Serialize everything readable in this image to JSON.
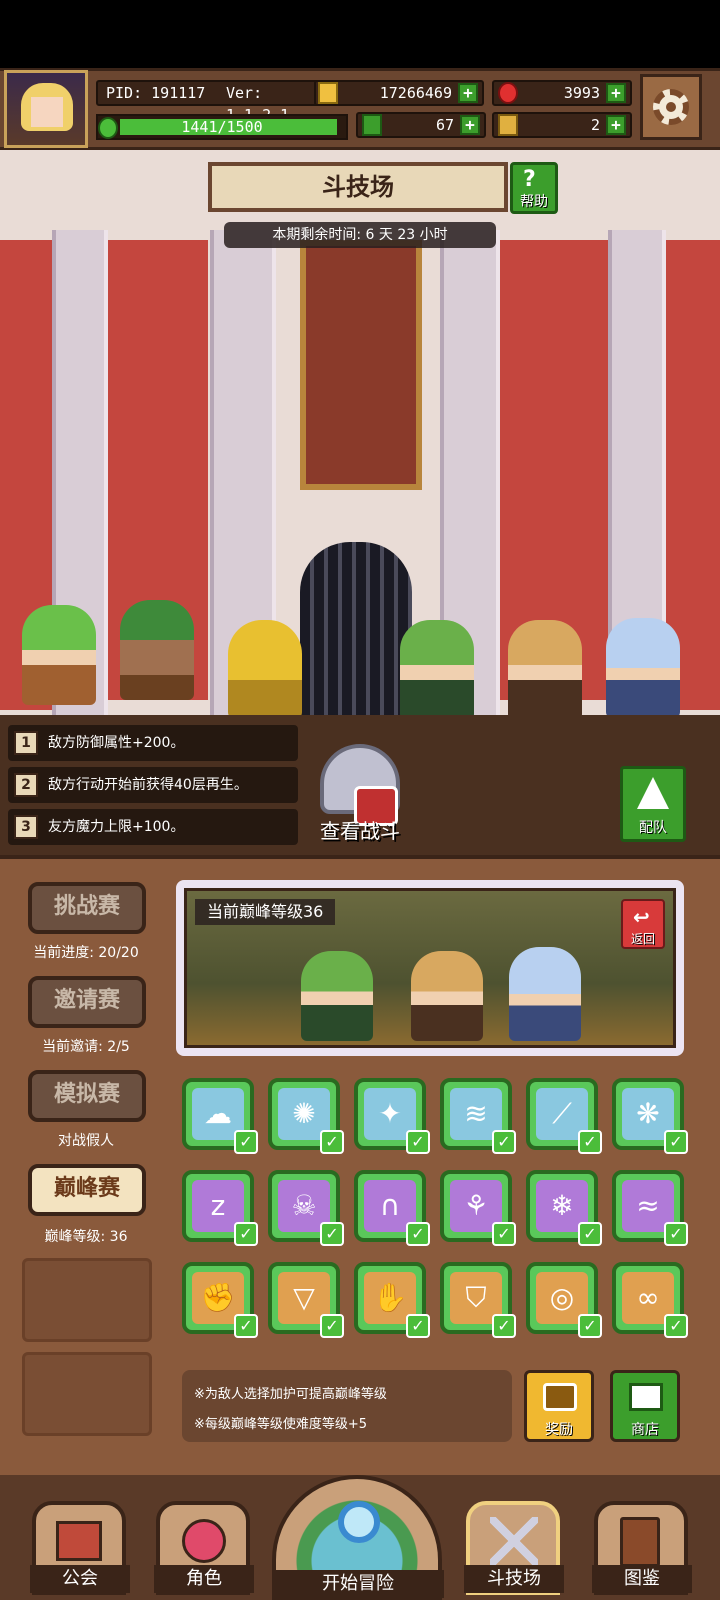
{
  "topbar": {
    "pid": "PID: 191117",
    "version": "Ver: 1.1.2.1",
    "gold": "17266469",
    "gems": "3993",
    "xp": "1441/1500",
    "xp_fraction": 0.96,
    "clovers": "67",
    "keys": "2",
    "plus_symbol": "+"
  },
  "scene": {
    "title": "斗技场",
    "help_label": "帮助",
    "timer": "本期剩余时间: 6 天 23 小时"
  },
  "rules": [
    {
      "num": "1",
      "text": "敌方防御属性+200。"
    },
    {
      "num": "2",
      "text": "敌方行动开始前获得40层再生。"
    },
    {
      "num": "3",
      "text": "友方魔力上限+100。"
    }
  ],
  "view_battle_label": "查看战斗",
  "team_label": "配队",
  "side": [
    {
      "label": "挑战赛",
      "sub": "当前进度: 20/20"
    },
    {
      "label": "邀请赛",
      "sub": "当前邀请: 2/5"
    },
    {
      "label": "模拟赛",
      "sub": "对战假人"
    },
    {
      "label": "巅峰赛",
      "sub": "巅峰等级: 36"
    }
  ],
  "preview": {
    "peak_level": "当前巅峰等级36",
    "back_label": "返回"
  },
  "modifiers": [
    {
      "icon": "cloud-icon",
      "glyph": "☁",
      "color": "#8ac8e0"
    },
    {
      "icon": "sun-icon",
      "glyph": "✺",
      "color": "#8ac8e0"
    },
    {
      "icon": "sparkle-icon",
      "glyph": "✦",
      "color": "#8ac8e0"
    },
    {
      "icon": "tornado-icon",
      "glyph": "≋",
      "color": "#8ac8e0"
    },
    {
      "icon": "blade-icon",
      "glyph": "⟋",
      "color": "#8ac8e0"
    },
    {
      "icon": "paw-icon",
      "glyph": "❋",
      "color": "#8ac8e0"
    },
    {
      "icon": "sleep-icon",
      "glyph": "z",
      "color": "#b07ad8"
    },
    {
      "icon": "skull-icon",
      "glyph": "☠",
      "color": "#b07ad8"
    },
    {
      "icon": "tomb-icon",
      "glyph": "∩",
      "color": "#b07ad8"
    },
    {
      "icon": "mushroom-icon",
      "glyph": "⚘",
      "color": "#b07ad8"
    },
    {
      "icon": "snowflake-icon",
      "glyph": "❄",
      "color": "#b07ad8"
    },
    {
      "icon": "wave-icon",
      "glyph": "≈",
      "color": "#b07ad8"
    },
    {
      "icon": "fist-icon",
      "glyph": "✊",
      "color": "#e0a050"
    },
    {
      "icon": "amulet-icon",
      "glyph": "▽",
      "color": "#e0a050"
    },
    {
      "icon": "claw-icon",
      "glyph": "✋",
      "color": "#e0a050"
    },
    {
      "icon": "shield-icon",
      "glyph": "⛉",
      "color": "#e0a050"
    },
    {
      "icon": "swirl-icon",
      "glyph": "◎",
      "color": "#e0a050"
    },
    {
      "icon": "infinity-icon",
      "glyph": "∞",
      "color": "#e0a050"
    }
  ],
  "notes": [
    "※为敌人选择加护可提高巅峰等级",
    "※每级巅峰等级使难度等级+5"
  ],
  "reward_label": "奖励",
  "shop_label": "商店",
  "nav": {
    "guild": "公会",
    "character": "角色",
    "start": "开始冒险",
    "arena": "斗技场",
    "codex": "图鉴"
  },
  "colors": {
    "accent_green": "#4bbd3a",
    "panel_brown": "#8a5a3c",
    "arena_red": "#c4463e"
  }
}
